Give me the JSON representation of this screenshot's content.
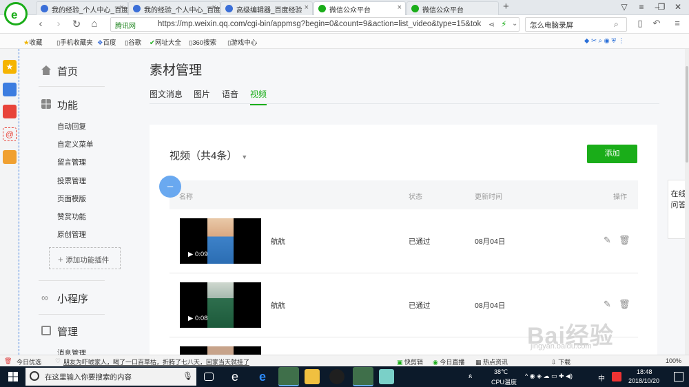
{
  "browser": {
    "tabs": [
      {
        "title": "我的经验_个人中心_百度",
        "icon_color": "#3b6fd8",
        "active": false
      },
      {
        "title": "我的经验_个人中心_百度",
        "icon_color": "#3b6fd8",
        "active": false
      },
      {
        "title": "高级编辑器_百度经验",
        "icon_color": "#3b6fd8",
        "active": false
      },
      {
        "title": "微信公众平台",
        "icon_color": "#1aad19",
        "active": true
      },
      {
        "title": "微信公众平台",
        "icon_color": "#1aad19",
        "active": false
      }
    ],
    "new_tab": "+",
    "secure_label": "腾讯网",
    "url": "https://mp.weixin.qq.com/cgi-bin/appmsg?begin=0&count=9&action=list_video&type=15&tok",
    "search_text": "怎么电脑录屏",
    "bookmarks": [
      "收藏",
      "手机收藏夹",
      "百度",
      "谷歌",
      "网址大全",
      "360搜索",
      "游戏中心"
    ]
  },
  "menu": {
    "home": "首页",
    "function": "功能",
    "function_items": [
      "自动回复",
      "自定义菜单",
      "留言管理",
      "投票管理",
      "页面模版",
      "赞赏功能",
      "原创管理"
    ],
    "add_plugin": "添加功能插件",
    "mini_program": "小程序",
    "manage": "管理",
    "manage_items": [
      "消息管理"
    ]
  },
  "main": {
    "title": "素材管理",
    "tabs": [
      "图文消息",
      "图片",
      "语音",
      "视频"
    ],
    "active_tab": "视频",
    "card_title": "视频（共4条）",
    "add_button": "添加",
    "columns": {
      "name": "名称",
      "status": "状态",
      "updated": "更新时间",
      "actions": "操作"
    },
    "rows": [
      {
        "duration": "▶ 0:09",
        "name": "航航",
        "status": "已通过",
        "date": "08月04日"
      },
      {
        "duration": "▶ 0:08",
        "name": "航航",
        "status": "已通过",
        "date": "08月04日"
      }
    ]
  },
  "float_help": "在线问答",
  "statusbar": {
    "left": "今日优选",
    "news": "朋友为吓唬家人，喝了一口百草枯，折腾了七八天，回家当天就挂了",
    "items": [
      "快剪辑",
      "今日直播",
      "热点资讯",
      "下载",
      "100%"
    ]
  },
  "taskbar": {
    "search_placeholder": "在这里输入你要搜索的内容",
    "temp": "38℃",
    "temp_label": "CPU温度",
    "ime": "中",
    "time": "18:48",
    "date": "2018/10/20"
  },
  "watermark": "Bai经验",
  "watermark_url": "jingyan.baidu.com"
}
